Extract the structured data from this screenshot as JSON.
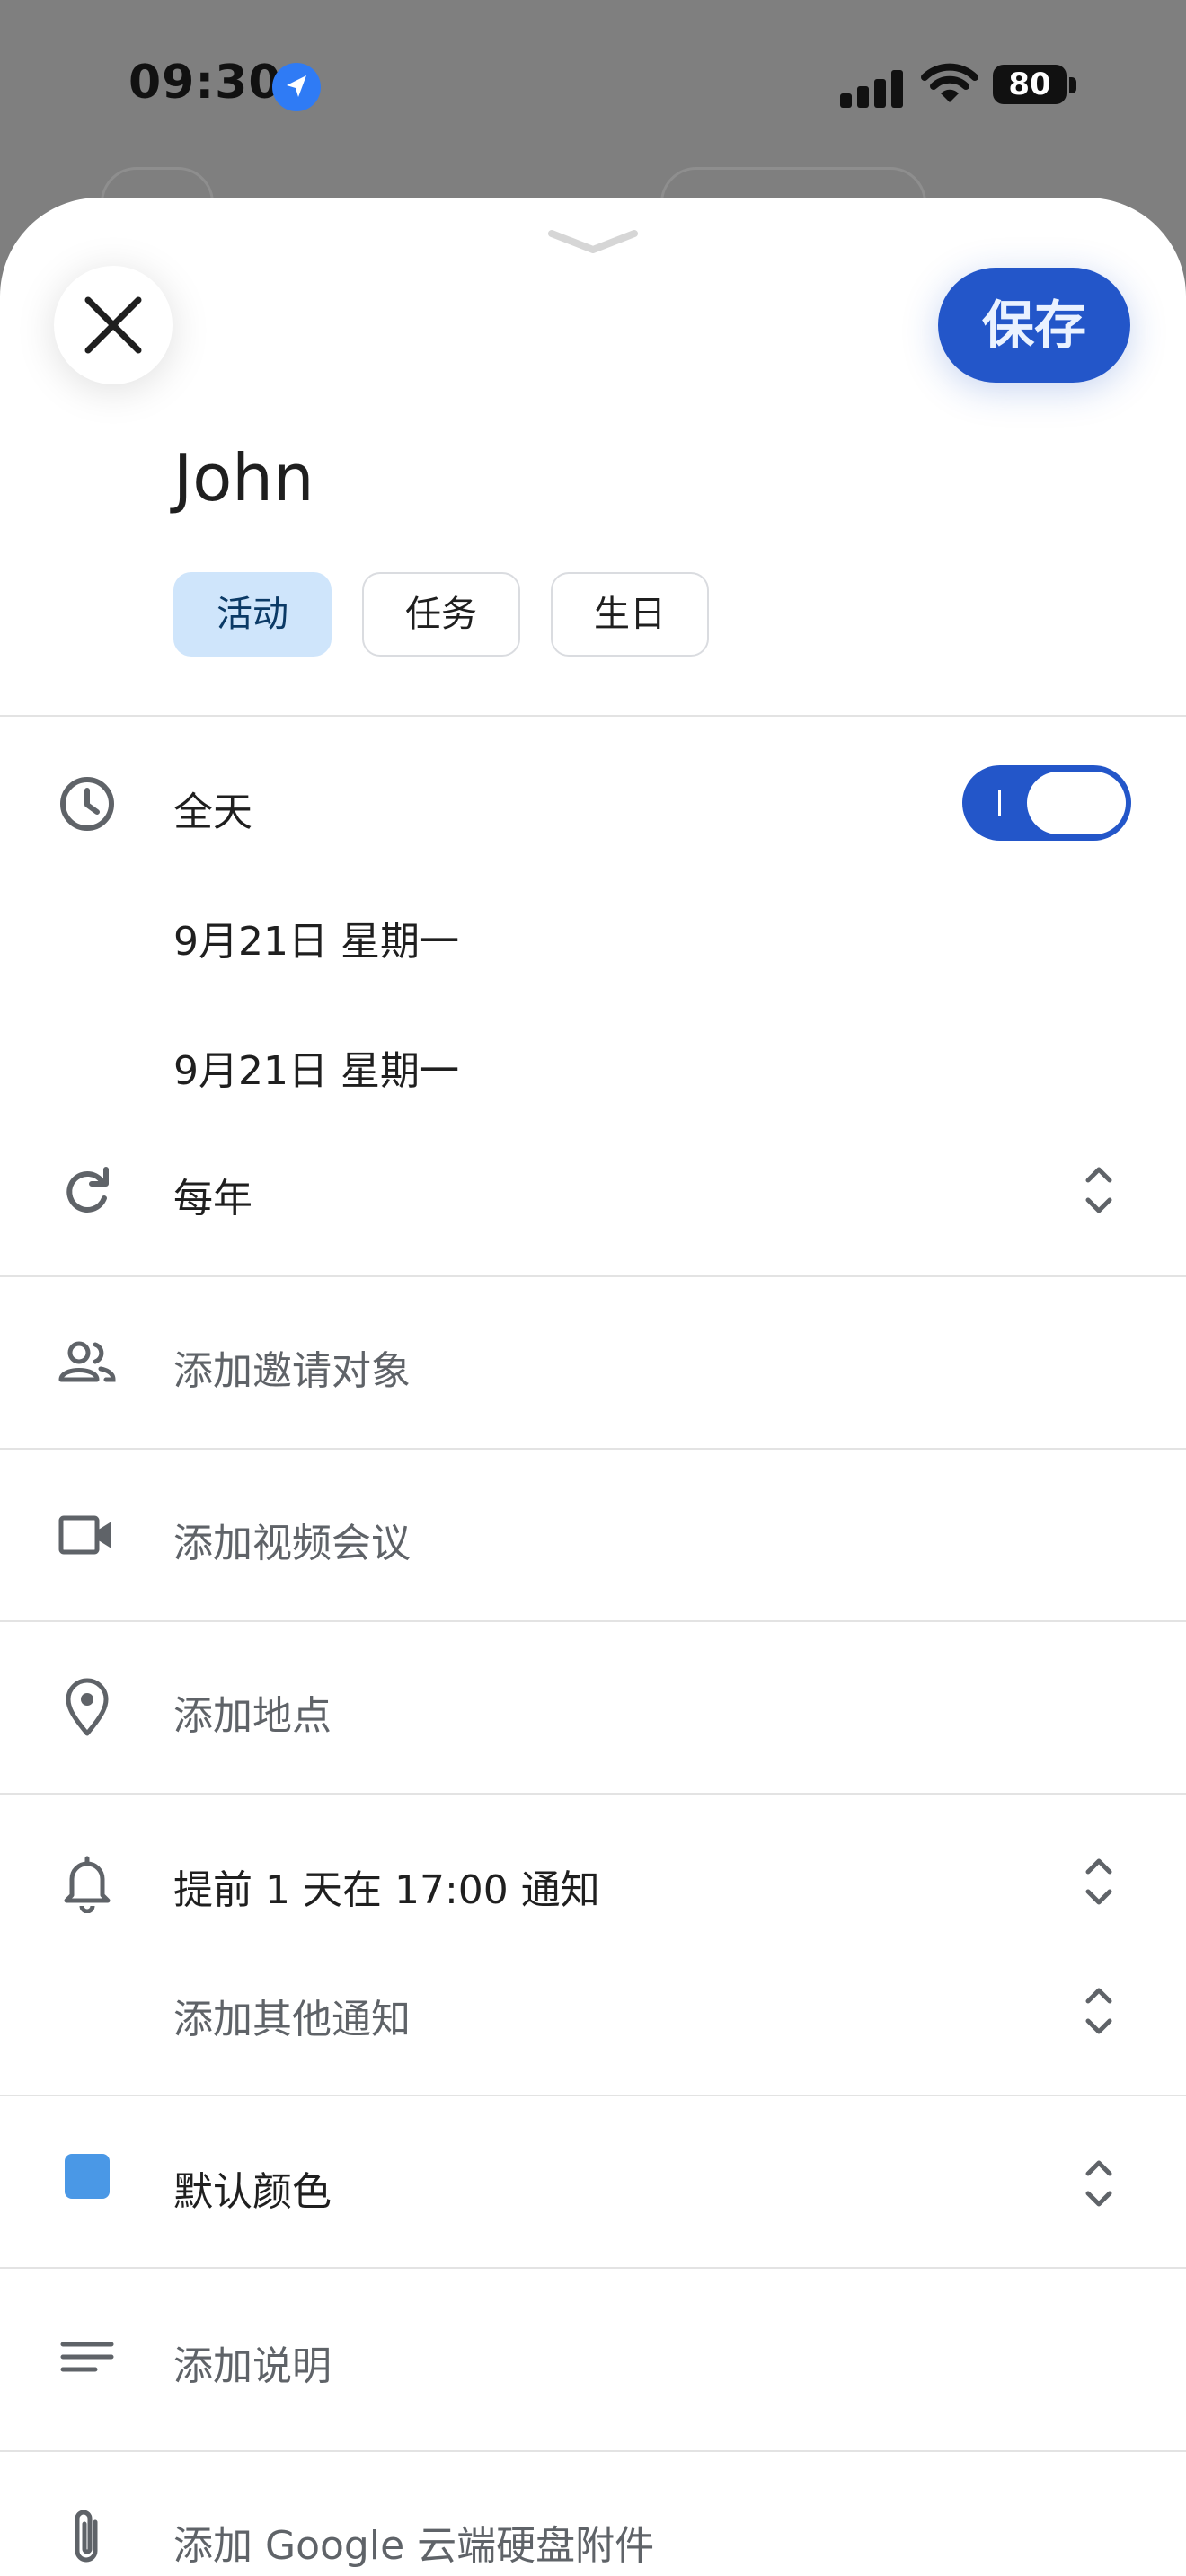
{
  "status_bar": {
    "time": "09:30",
    "battery": "80"
  },
  "header": {
    "close_icon": "close-icon",
    "save_label": "保存",
    "title": "John"
  },
  "types": [
    {
      "label": "活动",
      "active": true
    },
    {
      "label": "任务",
      "active": false
    },
    {
      "label": "生日",
      "active": false
    }
  ],
  "time": {
    "all_day_label": "全天",
    "all_day_on": true,
    "start_date": "9月21日 星期一",
    "end_date": "9月21日 星期一",
    "repeat": "每年"
  },
  "guests": {
    "placeholder": "添加邀请对象"
  },
  "video": {
    "placeholder": "添加视频会议"
  },
  "location": {
    "placeholder": "添加地点"
  },
  "notifications": {
    "primary": "提前 1 天在 17:00 通知",
    "add_more": "添加其他通知"
  },
  "color": {
    "label": "默认颜色",
    "value": "#4a98e6"
  },
  "description": {
    "placeholder": "添加说明"
  },
  "attachment": {
    "placeholder": "添加 Google 云端硬盘附件"
  },
  "colors": {
    "accent": "#2356c9",
    "chip_active": "#cfe5fb",
    "muted_text": "#5f6368"
  }
}
